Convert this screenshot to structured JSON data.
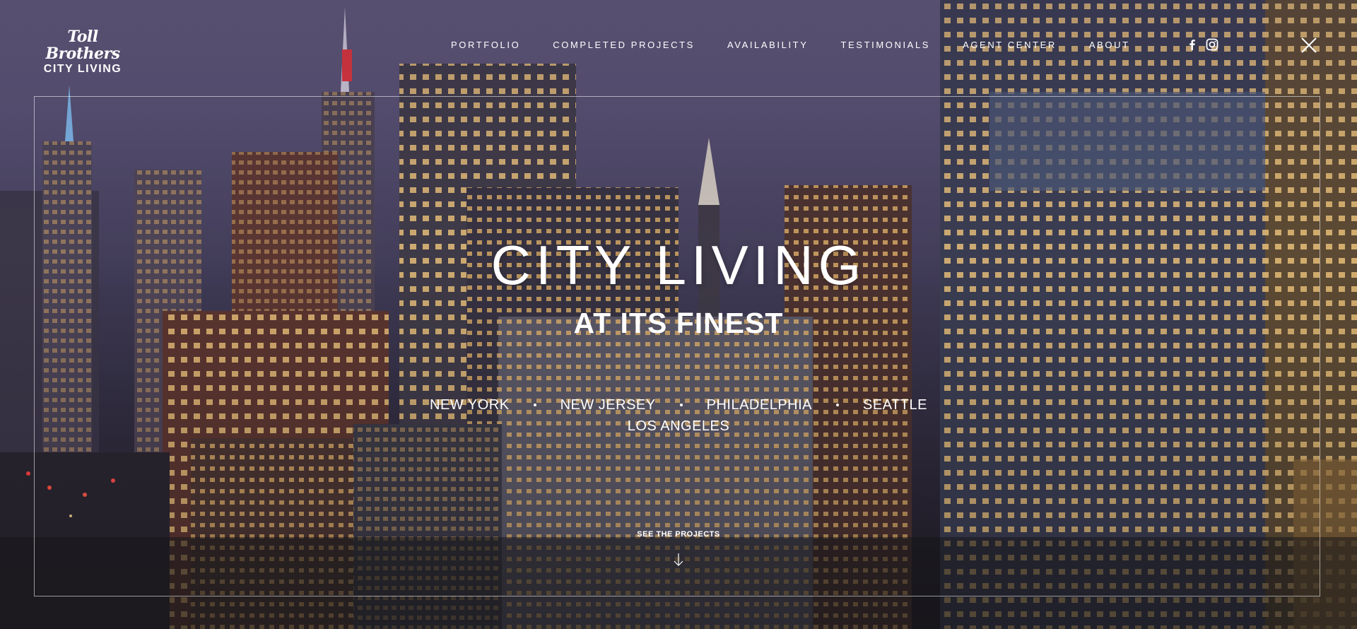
{
  "logo": {
    "brand": "Toll Brothers",
    "sub": "CITY LIVING"
  },
  "nav": {
    "items": [
      "PORTFOLIO",
      "COMPLETED PROJECTS",
      "AVAILABILITY",
      "TESTIMONIALS",
      "AGENT CENTER",
      "ABOUT"
    ]
  },
  "social": [
    "facebook-icon",
    "instagram-icon"
  ],
  "close_icon": "close-icon",
  "hero": {
    "title": "CITY LIVING",
    "subtitle": "AT ITS FINEST",
    "cities_row1": [
      "NEW YORK",
      "NEW JERSEY",
      "PHILADELPHIA",
      "SEATTLE"
    ],
    "cities_row2": [
      "LOS ANGELES"
    ],
    "cta": "SEE THE PROJECTS",
    "cta_icon": "arrow-down-icon"
  },
  "colors": {
    "sky": "#5f5877",
    "text": "#ffffff",
    "window_light": "#e8b86a",
    "accent_red": "#e0303a"
  }
}
